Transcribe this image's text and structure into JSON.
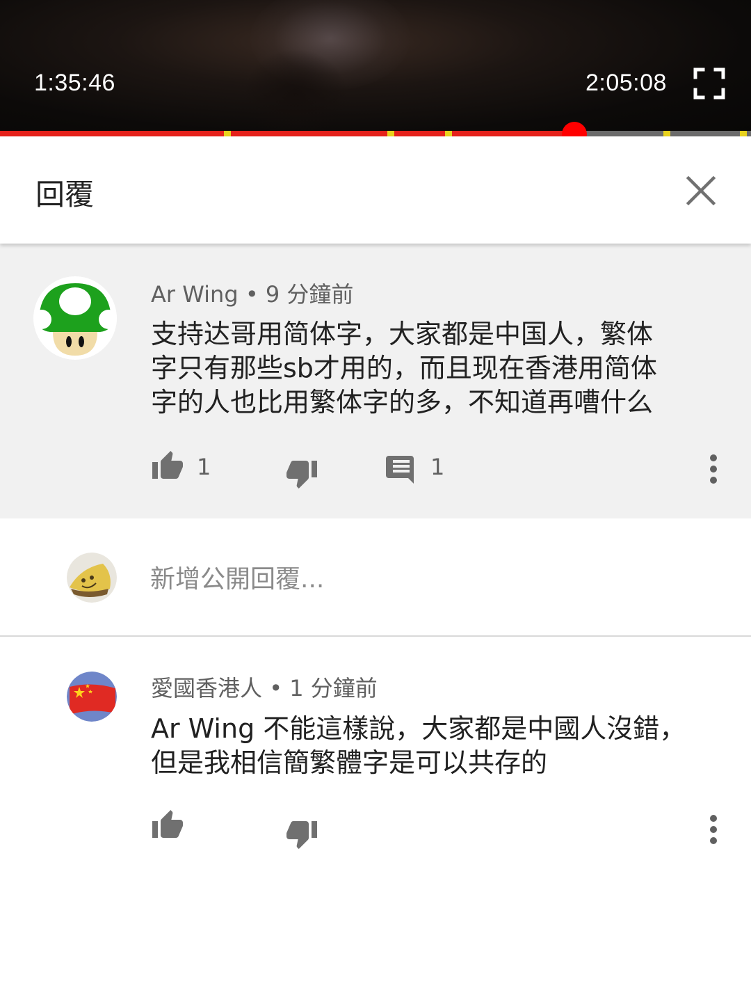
{
  "player": {
    "current_time": "1:35:46",
    "total_time": "2:05:08",
    "progress_fraction": 0.765,
    "ad_marker_fractions": [
      0.303,
      0.52,
      0.597,
      0.888,
      0.99
    ],
    "colors": {
      "played": "#e5211b",
      "scrubber": "#ff0000",
      "ad_marker": "#e8d21d"
    }
  },
  "header": {
    "title": "回覆"
  },
  "comment": {
    "author": "Ar Wing",
    "separator": "•",
    "time": "9 分鐘前",
    "text_lines": [
      "支持达哥用简体字，大家都是中国人，繁体",
      "字只有那些sb才用的，而且现在香港用简体",
      "字的人也比用繁体字的多，不知道再嘈什么"
    ],
    "likes": "1",
    "replies": "1"
  },
  "reply_box": {
    "placeholder": "新增公開回覆..."
  },
  "reply": {
    "author": "愛國香港人",
    "separator": "•",
    "time": "1 分鐘前",
    "text_lines": [
      "Ar Wing 不能這樣說，大家都是中國人沒錯，",
      "但是我相信簡繁體字是可以共存的"
    ]
  }
}
